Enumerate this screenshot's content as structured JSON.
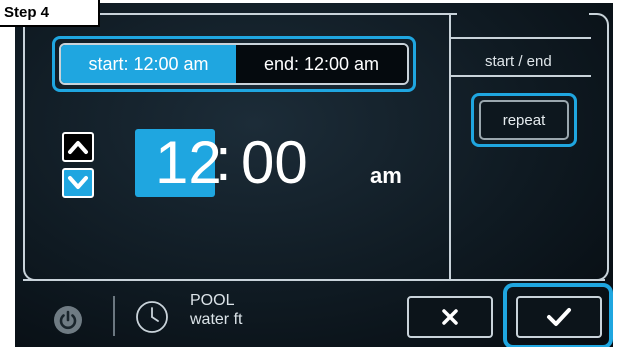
{
  "step_label": "Step 4",
  "toggle": {
    "start_label": "start: 12:00 am",
    "end_label": "end: 12:00 am",
    "selected": "start"
  },
  "side_menu": {
    "start_end_label": "start / end",
    "repeat_label": "repeat"
  },
  "time": {
    "hour": "12",
    "separator": ":",
    "minute": "00",
    "ampm": "am"
  },
  "footer": {
    "pool_line1": "POOL",
    "pool_line2": "water ft"
  },
  "icons": {
    "up": "chevron-up-icon",
    "down": "chevron-down-icon",
    "power": "power-icon",
    "clock": "clock-icon",
    "cancel": "close-icon",
    "confirm": "check-icon"
  },
  "colors": {
    "accent": "#1fa6e0",
    "background": "#0f1a22",
    "text": "#ffffff"
  }
}
